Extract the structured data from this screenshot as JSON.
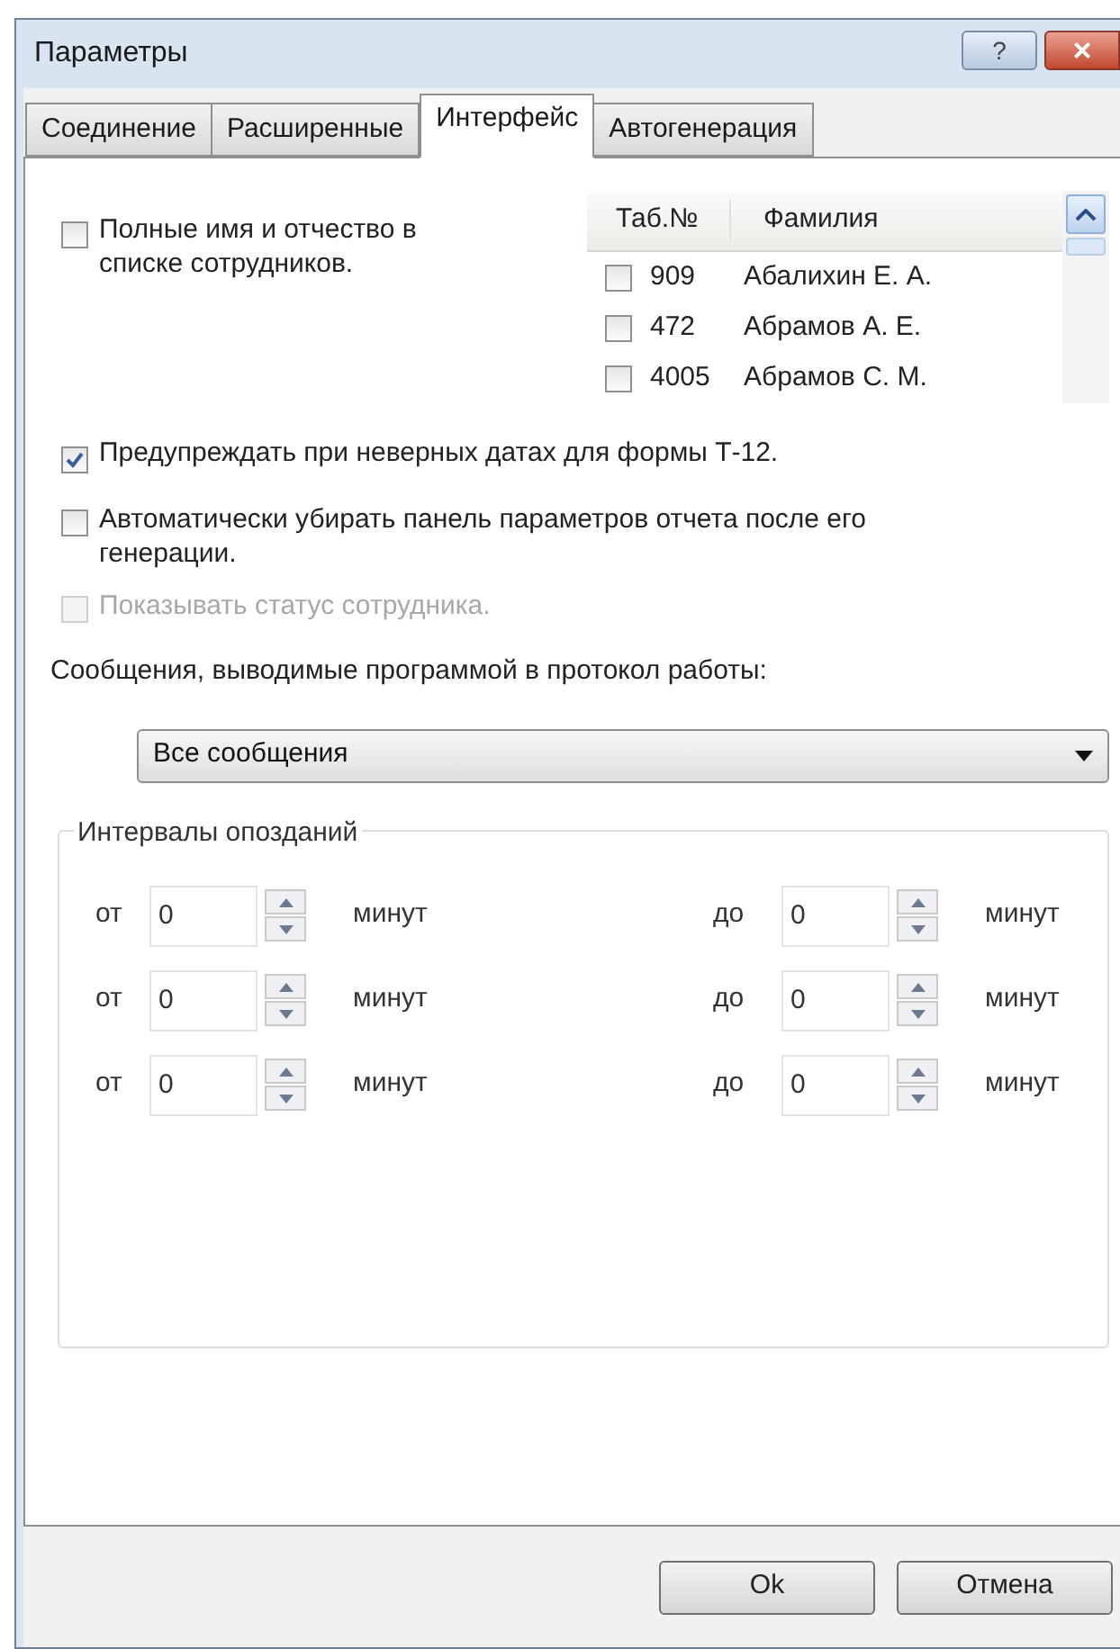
{
  "window": {
    "title": "Параметры",
    "help": "?",
    "close": "×"
  },
  "tabs": [
    {
      "label": "Соединение",
      "selected": false
    },
    {
      "label": "Расширенные",
      "selected": false
    },
    {
      "label": "Интерфейс",
      "selected": true
    },
    {
      "label": "Автогенерация",
      "selected": false
    }
  ],
  "full_names": {
    "label": "Полные имя и отчество в списке сотрудников.",
    "checked": false
  },
  "employees": {
    "columns": [
      "Таб.№",
      "Фамилия"
    ],
    "rows": [
      {
        "number": "909",
        "name": "Абалихин Е. А.",
        "checked": false
      },
      {
        "number": "472",
        "name": "Абрамов А. Е.",
        "checked": false
      },
      {
        "number": "4005",
        "name": "Абрамов С. М.",
        "checked": false
      }
    ]
  },
  "options": [
    {
      "label": "Предупреждать при неверных датах для формы Т-12.",
      "checked": true,
      "disabled": false
    },
    {
      "label": "Автоматически убирать панель параметров отчета после его генерации.",
      "checked": false,
      "disabled": false
    },
    {
      "label": "Показывать статус сотрудника.",
      "checked": false,
      "disabled": true
    }
  ],
  "messages": {
    "label": "Сообщения, выводимые программой в протокол работы:",
    "value": "Все сообщения"
  },
  "intervals": {
    "title": "Интервалы опозданий",
    "rows": [
      {
        "from_label": "от",
        "from": "0",
        "from_unit": "минут",
        "to_label": "до",
        "to": "0",
        "to_unit": "минут"
      },
      {
        "from_label": "от",
        "from": "0",
        "from_unit": "минут",
        "to_label": "до",
        "to": "0",
        "to_unit": "минут"
      },
      {
        "from_label": "от",
        "from": "0",
        "from_unit": "минут",
        "to_label": "до",
        "to": "0",
        "to_unit": "минут"
      }
    ]
  },
  "buttons": [
    "Ok",
    "Отмена"
  ]
}
